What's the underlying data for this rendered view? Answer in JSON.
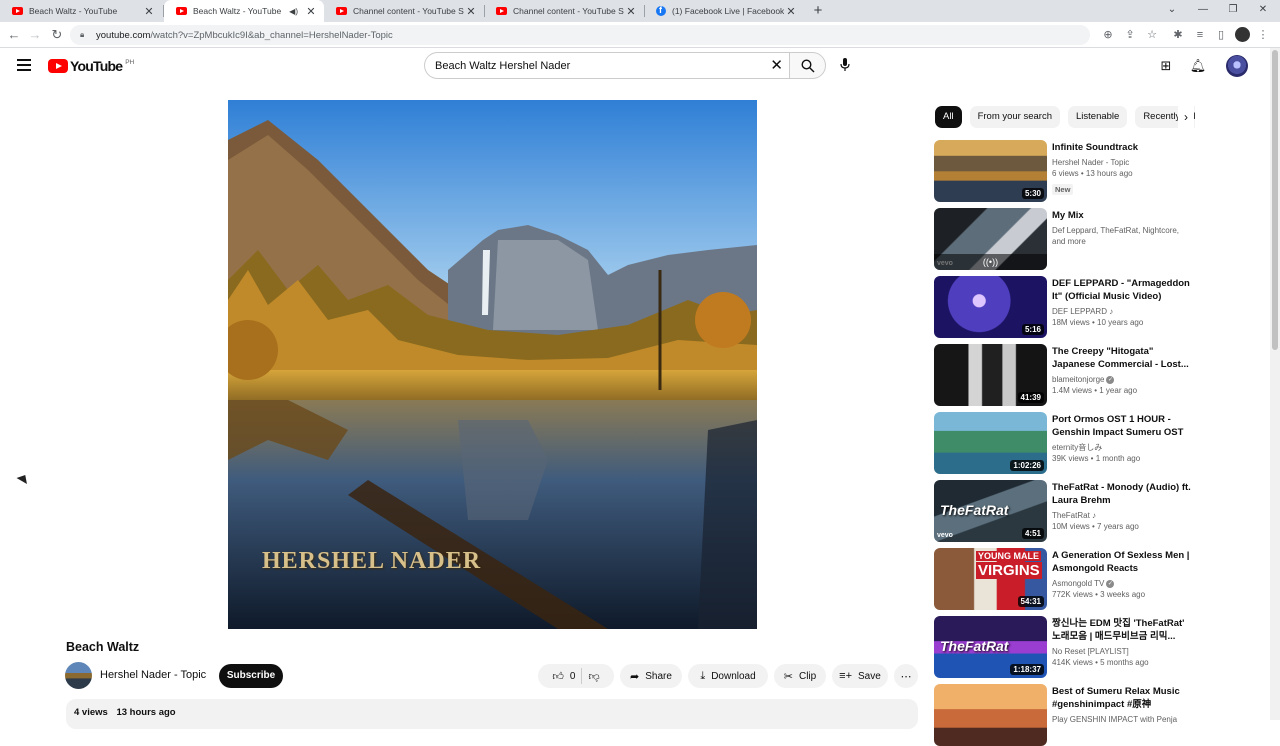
{
  "browser": {
    "tabs": [
      {
        "title": "Beach Waltz - YouTube",
        "favicon": "youtube-icon",
        "active": false
      },
      {
        "title": "Beach Waltz - YouTube",
        "favicon": "youtube-icon",
        "active": true,
        "audio": true
      },
      {
        "title": "Channel content - YouTube Studio",
        "favicon": "youtube-icon",
        "active": false
      },
      {
        "title": "Channel content - YouTube Studio",
        "favicon": "youtube-icon",
        "active": false
      },
      {
        "title": "(1) Facebook Live | Facebook",
        "favicon": "facebook-icon",
        "active": false
      }
    ],
    "new_tab": "+",
    "url_host": "youtube.com",
    "url_path": "/watch?v=ZpMbcukIc9I&ab_channel=HershelNader-Topic"
  },
  "masthead": {
    "logo_text": "YouTube",
    "country_code": "PH",
    "search_value": "Beach Waltz Hershel Nader"
  },
  "video": {
    "title": "Beach Waltz",
    "overlay_text": "HERSHEL NADER",
    "channel": "Hershel Nader - Topic",
    "subscribe_label": "Subscribe",
    "likes": "0",
    "share_label": "Share",
    "download_label": "Download",
    "clip_label": "Clip",
    "save_label": "Save",
    "views": "4 views",
    "published": "13 hours ago"
  },
  "chips": [
    "All",
    "From your search",
    "Listenable",
    "Recently uploaded"
  ],
  "recommendations": [
    {
      "title": "Infinite Soundtrack",
      "channel": "Hershel Nader - Topic",
      "meta": "6 views • 13 hours ago",
      "badge": "New",
      "duration": "5:30"
    },
    {
      "title": "My Mix",
      "channel": "Def Leppard, TheFatRat, Nightcore,",
      "meta": "and more",
      "duration": ""
    },
    {
      "title": "DEF LEPPARD - \"Armageddon It\" (Official Music Video)",
      "channel": "DEF LEPPARD ♪",
      "meta": "18M views • 10 years ago",
      "duration": "5:16"
    },
    {
      "title": "The Creepy \"Hitogata\" Japanese Commercial - Lost...",
      "channel": "blameitonjorge",
      "meta": "1.4M views • 1 year ago",
      "duration": "41:39"
    },
    {
      "title": "Port Ormos OST 1 HOUR - Genshin Impact Sumeru OST",
      "channel": "eternity音しみ",
      "meta": "39K views • 1 month ago",
      "duration": "1:02:26"
    },
    {
      "title": "TheFatRat - Monody (Audio) ft. Laura Brehm",
      "channel": "TheFatRat ♪",
      "meta": "10M views • 7 years ago",
      "duration": "4:51"
    },
    {
      "title": "A Generation Of Sexless Men | Asmongold Reacts",
      "channel": "Asmongold TV",
      "meta": "772K views • 3 weeks ago",
      "duration": "54:31"
    },
    {
      "title": "짱신나는 EDM 맛집 'TheFatRat' 노래모음 | 매드무비브금 리믹...",
      "channel": "No Reset [PLAYLIST]",
      "meta": "414K views • 5 months ago",
      "duration": "1:18:37"
    },
    {
      "title": "Best of Sumeru Relax Music #genshinimpact #原神",
      "channel": "Play GENSHIN IMPACT with Penja",
      "meta": "",
      "duration": ""
    }
  ],
  "thumb_text": {
    "fatrat1": "TheFatRat",
    "young_male": "YOUNG MALE",
    "virgins": "VIRGINS",
    "fatrat2": "TheFatRat",
    "vevo": "vevo"
  }
}
